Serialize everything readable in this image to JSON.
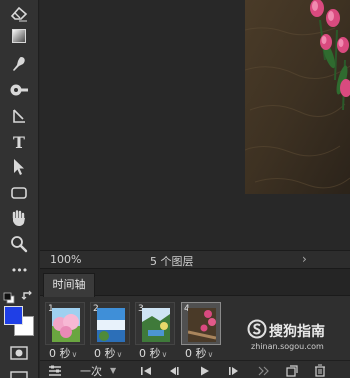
{
  "tools": [
    {
      "name": "eraser-tool-icon"
    },
    {
      "name": "gradient-tool-icon"
    },
    {
      "name": "blur-tool-icon"
    },
    {
      "name": "dodge-tool-icon"
    },
    {
      "name": "pen-tool-icon"
    },
    {
      "name": "type-tool-icon",
      "glyph": "T"
    },
    {
      "name": "path-selection-tool-icon"
    },
    {
      "name": "rectangle-tool-icon"
    },
    {
      "name": "hand-tool-icon"
    },
    {
      "name": "zoom-tool-icon"
    },
    {
      "name": "more-tools-icon",
      "glyph": "•••"
    }
  ],
  "colors": {
    "foreground": "#1f3fe6",
    "background": "#ffffff"
  },
  "status": {
    "zoom": "100%",
    "document_info": "5 个图层",
    "arrow": "›"
  },
  "timeline": {
    "tab_label": "时间轴",
    "frames": [
      {
        "number": "1",
        "delay": "0 秒",
        "thumbnail": "pink-flowers"
      },
      {
        "number": "2",
        "delay": "0 秒",
        "thumbnail": "blue-sky-waterfall"
      },
      {
        "number": "3",
        "delay": "0 秒",
        "thumbnail": "green-valley"
      },
      {
        "number": "4",
        "delay": "0 秒",
        "thumbnail": "tulips",
        "selected": true
      }
    ],
    "controls": {
      "loop": "一次"
    }
  },
  "watermark": {
    "title": "搜狗指南",
    "url": "zhinan.sogou.com"
  }
}
